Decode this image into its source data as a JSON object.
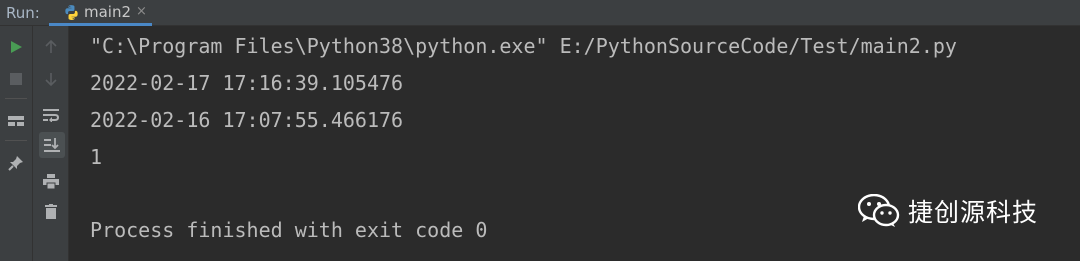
{
  "run_panel": {
    "run_label": "Run:",
    "tab": {
      "label": "main2",
      "close_glyph": "×",
      "icon": "python-icon"
    }
  },
  "toolbar": {
    "primary": [
      {
        "name": "run-icon",
        "color": "#499c54"
      },
      {
        "name": "stop-icon",
        "color": "#5a5d60"
      },
      {
        "name": "layout-icon",
        "color": "#afb1b3"
      },
      {
        "name": "pin-icon",
        "color": "#afb1b3"
      }
    ],
    "secondary": [
      {
        "name": "up-arrow-icon"
      },
      {
        "name": "down-arrow-icon"
      },
      {
        "name": "soft-wrap-icon"
      },
      {
        "name": "scroll-to-end-icon",
        "active": true
      },
      {
        "name": "print-icon"
      },
      {
        "name": "trash-icon"
      }
    ]
  },
  "console": {
    "lines": [
      "\"C:\\Program Files\\Python38\\python.exe\" E:/PythonSourceCode/Test/main2.py",
      "2022-02-17 17:16:39.105476",
      "2022-02-16 17:07:55.466176",
      "1",
      "",
      "Process finished with exit code 0"
    ]
  },
  "watermark": {
    "text": "捷创源科技",
    "icon": "wechat-icon"
  },
  "colors": {
    "background": "#2b2b2b",
    "panel": "#3c3f41",
    "text": "#bbbbbb",
    "accent": "#4a88c7",
    "run_green": "#499c54"
  }
}
